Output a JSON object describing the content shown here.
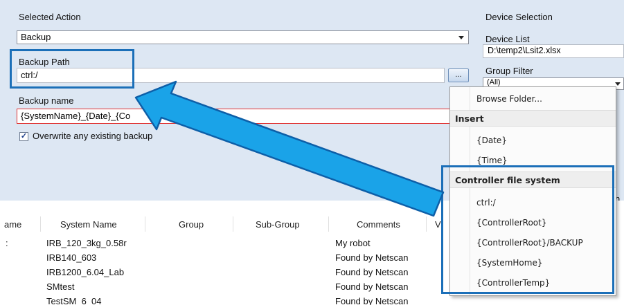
{
  "selected_action": {
    "label": "Selected Action",
    "value": "Backup"
  },
  "backup_path": {
    "label": "Backup Path",
    "value": "ctrl:/",
    "browse_label": "..."
  },
  "backup_name": {
    "label": "Backup name",
    "value": "{SystemName}_{Date}_{Co"
  },
  "overwrite": {
    "label": "Overwrite any existing backup",
    "checked": true
  },
  "device_selection": {
    "title": "Device Selection",
    "device_list_label": "Device List",
    "device_list_value": "D:\\temp2\\Lsit2.xlsx",
    "group_filter_label": "Group Filter",
    "group_filter_value": "(All)",
    "peek_text": "n"
  },
  "grid": {
    "columns": [
      "ame",
      "System Name",
      "Group",
      "Sub-Group",
      "Comments",
      "V"
    ],
    "rows": [
      {
        "name": ":",
        "system": "IRB_120_3kg_0.58r",
        "comments": "My robot"
      },
      {
        "name": "",
        "system": "IRB140_603",
        "comments": "Found by Netscan"
      },
      {
        "name": "",
        "system": "IRB1200_6.04_Lab",
        "comments": "Found by Netscan"
      },
      {
        "name": "",
        "system": "SMtest",
        "comments": "Found by Netscan"
      },
      {
        "name": "",
        "system": "TestSM_6_04",
        "comments": "Found by Netscan"
      }
    ]
  },
  "menu": {
    "browse_folder": "Browse Folder...",
    "insert_header": "Insert",
    "insert_items": [
      "{Date}",
      "{Time}"
    ],
    "controller_header": "Controller file system",
    "controller_items": [
      "ctrl:/",
      "{ControllerRoot}",
      "{ControllerRoot}/BACKUP",
      "{SystemHome}",
      "{ControllerTemp}"
    ]
  },
  "colors": {
    "panel_bg": "#dde7f3",
    "highlight": "#1b6fb8",
    "arrow_fill": "#1aa3e8",
    "error_border": "#e03030"
  }
}
